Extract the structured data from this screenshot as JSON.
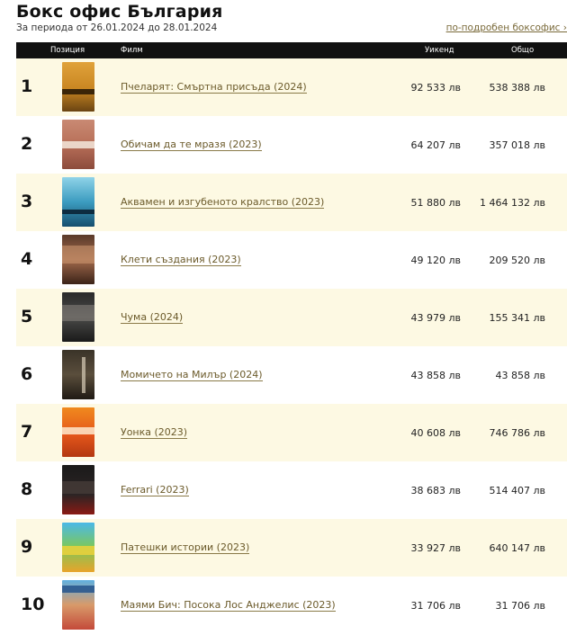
{
  "header": {
    "title": "Бокс офис България",
    "period": "За периода от 26.01.2024 до 28.01.2024",
    "more_link": "по-подробен боксофис ›"
  },
  "table": {
    "columns": [
      "Позиция",
      "Филм",
      "Уикенд",
      "Общо"
    ],
    "rows": [
      {
        "rank": "1",
        "film": "Пчеларят: Смъртна присъда (2024)",
        "weekend": "92 533 лв",
        "total": "538 388 лв"
      },
      {
        "rank": "2",
        "film": "Обичам да те мразя (2023)",
        "weekend": "64 207 лв",
        "total": "357 018 лв"
      },
      {
        "rank": "3",
        "film": "Аквамен и изгубеното кралство (2023)",
        "weekend": "51 880 лв",
        "total": "1 464 132 лв"
      },
      {
        "rank": "4",
        "film": "Клети създания (2023)",
        "weekend": "49 120 лв",
        "total": "209 520 лв"
      },
      {
        "rank": "5",
        "film": "Чума (2024)",
        "weekend": "43 979 лв",
        "total": "155 341 лв"
      },
      {
        "rank": "6",
        "film": "Момичето на Милър (2024)",
        "weekend": "43 858 лв",
        "total": "43 858 лв"
      },
      {
        "rank": "7",
        "film": "Уонка (2023)",
        "weekend": "40 608 лв",
        "total": "746 786 лв"
      },
      {
        "rank": "8",
        "film": "Ferrari (2023)",
        "weekend": "38 683 лв",
        "total": "514 407 лв"
      },
      {
        "rank": "9",
        "film": "Патешки истории (2023)",
        "weekend": "33 927 лв",
        "total": "640 147 лв"
      },
      {
        "rank": "10",
        "film": "Маями Бич: Посока Лос Анджелис (2023)",
        "weekend": "31 706 лв",
        "total": "31 706 лв"
      }
    ]
  },
  "colors": {
    "header_bg": "#111111",
    "row_highlight": "#fdf9e3",
    "link": "#6b5a2a"
  }
}
